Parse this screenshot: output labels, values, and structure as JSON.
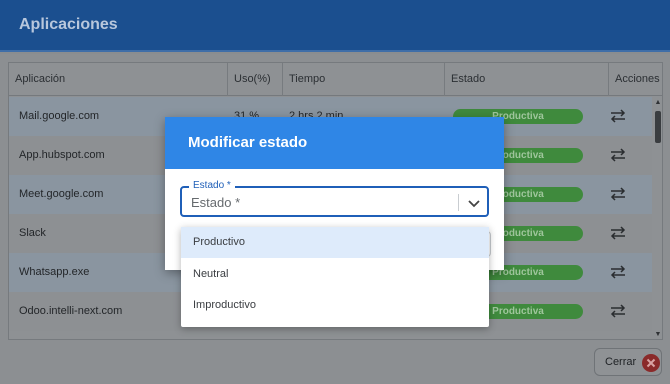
{
  "app": {
    "title": "Aplicaciones"
  },
  "table": {
    "columns": [
      "Aplicación",
      "Uso(%)",
      "Tiempo",
      "Estado",
      "Acciones"
    ],
    "rows": [
      {
        "app": "Mail.google.com",
        "uso": "31 %",
        "tiempo": "2 hrs 2 min",
        "estado": "Productiva"
      },
      {
        "app": "App.hubspot.com",
        "uso": "",
        "tiempo": "",
        "estado": "Productiva"
      },
      {
        "app": "Meet.google.com",
        "uso": "",
        "tiempo": "",
        "estado": "Productiva"
      },
      {
        "app": "Slack",
        "uso": "",
        "tiempo": "",
        "estado": "Productiva"
      },
      {
        "app": "Whatsapp.exe",
        "uso": "",
        "tiempo": "",
        "estado": "Productiva"
      },
      {
        "app": "Odoo.intelli-next.com",
        "uso": "",
        "tiempo": "",
        "estado": "Productiva"
      }
    ]
  },
  "footer": {
    "close_label": "Cerrar"
  },
  "modal": {
    "title": "Modificar estado",
    "field": {
      "legend": "Estado *",
      "value": "Estado *"
    },
    "options": [
      "Productivo",
      "Neutral",
      "Improductivo"
    ],
    "highlighted_option": "Productivo"
  },
  "colors": {
    "header": "#1b4f8f",
    "modal_header": "#2f86e6",
    "badge_productiva": "#3f8a3d",
    "focus_border": "#1f5fb8"
  },
  "icons": [
    "swap-icon",
    "chevron-down-icon",
    "close-circle-icon"
  ]
}
